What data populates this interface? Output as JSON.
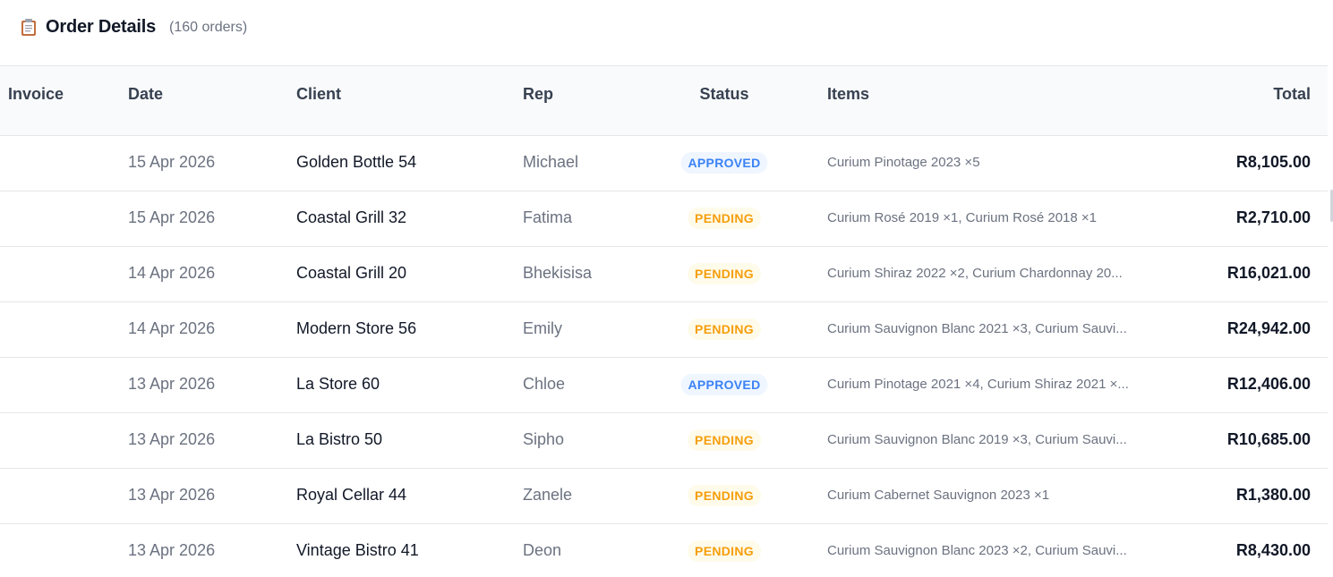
{
  "header": {
    "icon": "clipboard-icon",
    "title": "Order Details",
    "count": "(160 orders)"
  },
  "columns": {
    "invoice": "Invoice",
    "date": "Date",
    "client": "Client",
    "rep": "Rep",
    "status": "Status",
    "items": "Items",
    "total": "Total"
  },
  "rows": [
    {
      "invoice": "",
      "date": "15 Apr 2026",
      "client": "Golden Bottle 54",
      "rep": "Michael",
      "status": "APPROVED",
      "status_type": "approved",
      "items": "Curium Pinotage 2023 ×5",
      "total": "R8,105.00"
    },
    {
      "invoice": "",
      "date": "15 Apr 2026",
      "client": "Coastal Grill 32",
      "rep": "Fatima",
      "status": "PENDING",
      "status_type": "pending",
      "items": "Curium Rosé 2019 ×1, Curium Rosé 2018 ×1",
      "total": "R2,710.00"
    },
    {
      "invoice": "",
      "date": "14 Apr 2026",
      "client": "Coastal Grill 20",
      "rep": "Bhekisisa",
      "status": "PENDING",
      "status_type": "pending",
      "items": "Curium Shiraz 2022 ×2, Curium Chardonnay 20...",
      "total": "R16,021.00"
    },
    {
      "invoice": "",
      "date": "14 Apr 2026",
      "client": "Modern Store 56",
      "rep": "Emily",
      "status": "PENDING",
      "status_type": "pending",
      "items": "Curium Sauvignon Blanc 2021 ×3, Curium Sauvi...",
      "total": "R24,942.00"
    },
    {
      "invoice": "",
      "date": "13 Apr 2026",
      "client": "La Store 60",
      "rep": "Chloe",
      "status": "APPROVED",
      "status_type": "approved",
      "items": "Curium Pinotage 2021 ×4, Curium Shiraz 2021 ×...",
      "total": "R12,406.00"
    },
    {
      "invoice": "",
      "date": "13 Apr 2026",
      "client": "La Bistro 50",
      "rep": "Sipho",
      "status": "PENDING",
      "status_type": "pending",
      "items": "Curium Sauvignon Blanc 2019 ×3, Curium Sauvi...",
      "total": "R10,685.00"
    },
    {
      "invoice": "",
      "date": "13 Apr 2026",
      "client": "Royal Cellar 44",
      "rep": "Zanele",
      "status": "PENDING",
      "status_type": "pending",
      "items": "Curium Cabernet Sauvignon 2023 ×1",
      "total": "R1,380.00"
    },
    {
      "invoice": "",
      "date": "13 Apr 2026",
      "client": "Vintage Bistro 41",
      "rep": "Deon",
      "status": "PENDING",
      "status_type": "pending",
      "items": "Curium Sauvignon Blanc 2023 ×2, Curium Sauvi...",
      "total": "R8,430.00"
    }
  ],
  "colors": {
    "approved": "#3b82f6",
    "pending": "#f59e0b"
  }
}
